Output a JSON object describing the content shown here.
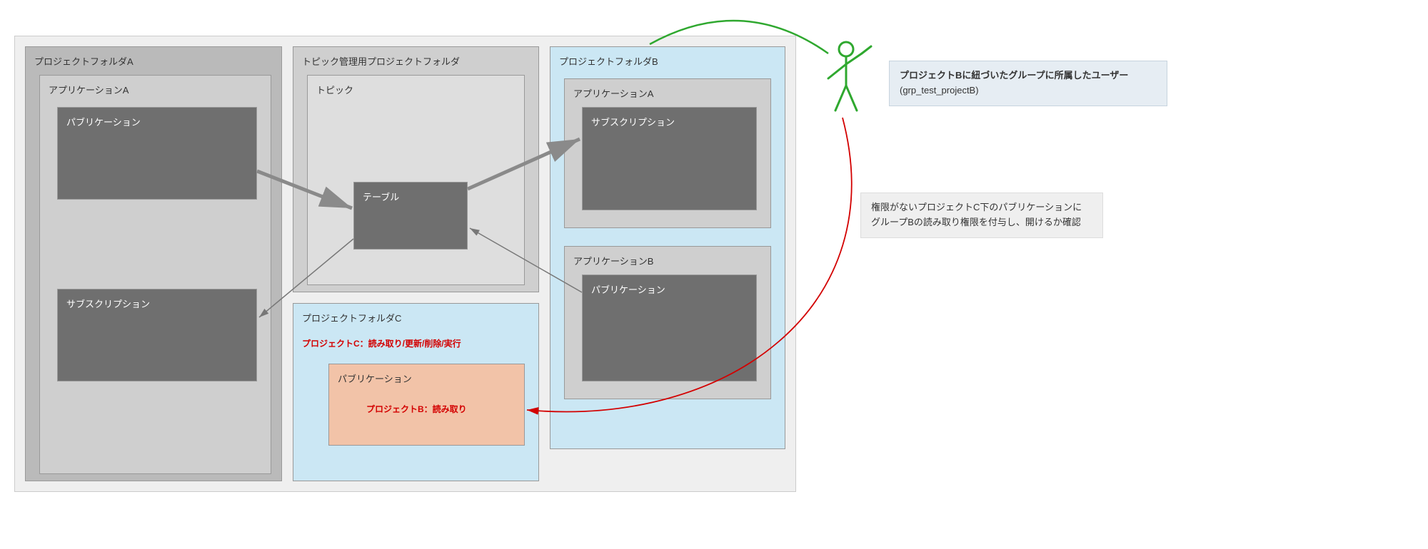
{
  "outer": {
    "folderA": {
      "title": "プロジェクトフォルダA",
      "appA": {
        "title": "アプリケーションA",
        "pub": "パブリケーション",
        "sub": "サブスクリプション"
      }
    },
    "topicFolder": {
      "title": "トピック管理用プロジェクトフォルダ",
      "topic": {
        "title": "トピック",
        "table": "テーブル"
      }
    },
    "folderC": {
      "title": "プロジェクトフォルダC",
      "perm": "プロジェクトC：読み取り/更新/削除/実行",
      "pub": "パブリケーション",
      "pubPerm": "プロジェクトB：読み取り"
    },
    "folderB": {
      "title": "プロジェクトフォルダB",
      "appA": {
        "title": "アプリケーションA",
        "sub": "サブスクリプション"
      },
      "appB": {
        "title": "アプリケーションB",
        "pub": "パブリケーション"
      }
    }
  },
  "user": {
    "line1": "プロジェクトBに紐づいたグループに所属したユーザー",
    "line2": "(grp_test_projectB)"
  },
  "note": {
    "line1": "権限がないプロジェクトC下のパブリケーションに",
    "line2": "グループBの読み取り権限を付与し、開けるか確認"
  }
}
